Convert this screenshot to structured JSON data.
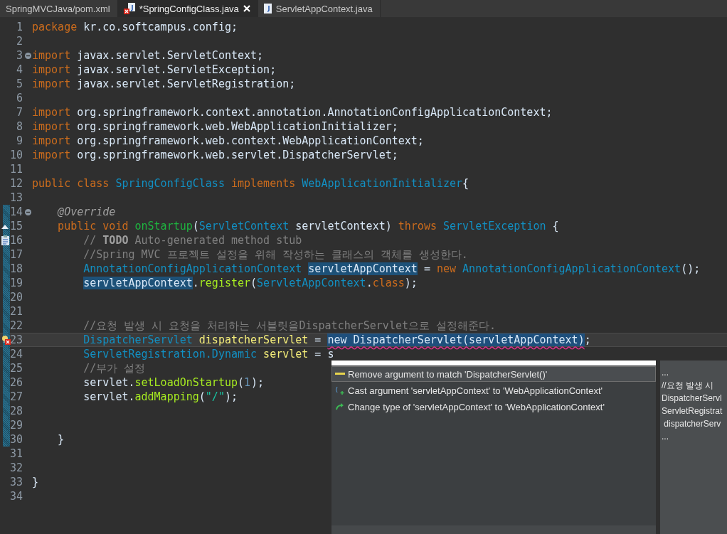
{
  "tabs": [
    {
      "label": "SpringMVCJava/pom.xml",
      "kind": "xml",
      "selected": false
    },
    {
      "label": "*SpringConfigClass.java",
      "kind": "java-error",
      "selected": true
    },
    {
      "label": "ServletAppContext.java",
      "kind": "java",
      "selected": false
    }
  ],
  "lines": [
    {
      "number": "1",
      "kind": "plain",
      "fold": false,
      "ruler": false,
      "current": false,
      "segments": [
        {
          "text": "package ",
          "kind": "kw"
        },
        {
          "text": "kr.co.softcampus.config;",
          "kind": "tx"
        }
      ]
    },
    {
      "number": "2",
      "kind": "plain",
      "fold": false,
      "ruler": false,
      "current": false
    },
    {
      "number": "3",
      "kind": "plain",
      "fold": true,
      "ruler": false,
      "current": false,
      "segments": [
        {
          "text": "import ",
          "kind": "kw"
        },
        {
          "text": "javax.servlet.ServletContext;",
          "kind": "tx"
        }
      ]
    },
    {
      "number": "4",
      "kind": "plain",
      "fold": false,
      "ruler": false,
      "current": false,
      "segments": [
        {
          "text": "import ",
          "kind": "kw"
        },
        {
          "text": "javax.servlet.ServletException;",
          "kind": "tx"
        }
      ]
    },
    {
      "number": "5",
      "kind": "plain",
      "fold": false,
      "ruler": false,
      "current": false,
      "segments": [
        {
          "text": "import ",
          "kind": "kw"
        },
        {
          "text": "javax.servlet.ServletRegistration;",
          "kind": "tx"
        }
      ]
    },
    {
      "number": "6",
      "kind": "plain",
      "fold": false,
      "ruler": false,
      "current": false
    },
    {
      "number": "7",
      "kind": "plain",
      "fold": false,
      "ruler": false,
      "current": false,
      "segments": [
        {
          "text": "import ",
          "kind": "kw"
        },
        {
          "text": "org.springframework.context.annotation.AnnotationConfigApplicationContext;",
          "kind": "tx"
        }
      ]
    },
    {
      "number": "8",
      "kind": "plain",
      "fold": false,
      "ruler": false,
      "current": false,
      "segments": [
        {
          "text": "import ",
          "kind": "kw"
        },
        {
          "text": "org.springframework.web.WebApplicationInitializer;",
          "kind": "tx"
        }
      ]
    },
    {
      "number": "9",
      "kind": "plain",
      "fold": false,
      "ruler": false,
      "current": false,
      "segments": [
        {
          "text": "import ",
          "kind": "kw"
        },
        {
          "text": "org.springframework.web.context.WebApplicationContext;",
          "kind": "tx"
        }
      ]
    },
    {
      "number": "10",
      "kind": "plain",
      "fold": false,
      "ruler": false,
      "current": false,
      "segments": [
        {
          "text": "import ",
          "kind": "kw"
        },
        {
          "text": "org.springframework.web.servlet.DispatcherServlet;",
          "kind": "tx"
        }
      ]
    },
    {
      "number": "11",
      "kind": "plain",
      "fold": false,
      "ruler": false,
      "current": false
    },
    {
      "number": "12",
      "kind": "plain",
      "fold": false,
      "ruler": false,
      "current": false,
      "segments": [
        {
          "text": "public class ",
          "kind": "kw"
        },
        {
          "text": "SpringConfigClass ",
          "kind": "type"
        },
        {
          "text": "implements ",
          "kind": "kw"
        },
        {
          "text": "WebApplicationInitializer",
          "kind": "type"
        },
        {
          "text": "{",
          "kind": "tx"
        }
      ]
    },
    {
      "number": "13",
      "kind": "plain",
      "fold": false,
      "ruler": false,
      "current": false
    },
    {
      "number": "14",
      "kind": "plain",
      "fold": true,
      "ruler": true,
      "current": false,
      "segments": [
        {
          "text": "    @Override",
          "kind": "ann"
        }
      ]
    },
    {
      "number": "15",
      "kind": "override",
      "fold": false,
      "ruler": true,
      "current": false,
      "segments": [
        {
          "text": "    public void ",
          "kind": "kw"
        },
        {
          "text": "onStartup",
          "kind": "fn"
        },
        {
          "text": "(",
          "kind": "tx"
        },
        {
          "text": "ServletContext ",
          "kind": "type"
        },
        {
          "text": "servletContext) ",
          "kind": "tx"
        },
        {
          "text": "throws ",
          "kind": "kw"
        },
        {
          "text": "ServletException",
          "kind": "type"
        },
        {
          "text": " {",
          "kind": "tx"
        }
      ]
    },
    {
      "number": "16",
      "kind": "task",
      "fold": false,
      "ruler": true,
      "current": false,
      "segments": [
        {
          "text": "        // ",
          "kind": "cm"
        },
        {
          "text": "TODO",
          "kind": "cmb"
        },
        {
          "text": " Auto-generated method stub",
          "kind": "cm"
        }
      ]
    },
    {
      "number": "17",
      "kind": "plain",
      "fold": false,
      "ruler": true,
      "current": false,
      "segments": [
        {
          "text": "        //Spring MVC 프로젝트 설정을 위해 작성하는 클래스의 객체를 생성한다.",
          "kind": "cm"
        }
      ]
    },
    {
      "number": "18",
      "kind": "plain",
      "fold": false,
      "ruler": true,
      "current": false,
      "segments": [
        {
          "text": "        AnnotationConfigApplicationContext ",
          "kind": "type"
        },
        {
          "text": "servletAppContext",
          "kind": "mark"
        },
        {
          "text": " = ",
          "kind": "tx"
        },
        {
          "text": "new ",
          "kind": "kw"
        },
        {
          "text": "AnnotationConfigApplicationContext",
          "kind": "type"
        },
        {
          "text": "();",
          "kind": "tx"
        }
      ]
    },
    {
      "number": "19",
      "kind": "plain",
      "fold": false,
      "ruler": true,
      "current": false,
      "segments": [
        {
          "text": "        servletAppContext",
          "kind": "mark"
        },
        {
          "text": ".",
          "kind": "tx"
        },
        {
          "text": "register",
          "kind": "call"
        },
        {
          "text": "(",
          "kind": "tx"
        },
        {
          "text": "ServletAppContext",
          "kind": "type"
        },
        {
          "text": ".",
          "kind": "tx"
        },
        {
          "text": "class",
          "kind": "kw"
        },
        {
          "text": ");",
          "kind": "tx"
        }
      ]
    },
    {
      "number": "20",
      "kind": "plain",
      "fold": false,
      "ruler": true,
      "current": false
    },
    {
      "number": "21",
      "kind": "plain",
      "fold": false,
      "ruler": true,
      "current": false
    },
    {
      "number": "22",
      "kind": "plain",
      "fold": false,
      "ruler": true,
      "current": false,
      "segments": [
        {
          "text": "        //요청 발생 시 요청을 처리하는 서블릿을DispatcherServlet으로 설정해준다.",
          "kind": "cm"
        }
      ]
    },
    {
      "number": "23",
      "kind": "error",
      "fold": false,
      "ruler": true,
      "current": true,
      "segments": [
        {
          "text": "        DispatcherServlet ",
          "kind": "type"
        },
        {
          "text": "dispatcherServlet",
          "kind": "var"
        },
        {
          "text": " = ",
          "kind": "tx"
        },
        {
          "text": "new DispatcherServlet(servletAppContext)",
          "kind": "sel"
        },
        {
          "text": ";",
          "kind": "tx"
        }
      ]
    },
    {
      "number": "24",
      "kind": "plain",
      "fold": false,
      "ruler": true,
      "current": false,
      "segments": [
        {
          "text": "        ServletRegistration.Dynamic ",
          "kind": "type"
        },
        {
          "text": "servlet",
          "kind": "var"
        },
        {
          "text": " = s",
          "kind": "tx"
        }
      ]
    },
    {
      "number": "25",
      "kind": "plain",
      "fold": false,
      "ruler": true,
      "current": false,
      "segments": [
        {
          "text": "        //부가 설정",
          "kind": "cm"
        }
      ]
    },
    {
      "number": "26",
      "kind": "plain",
      "fold": false,
      "ruler": true,
      "current": false,
      "segments": [
        {
          "text": "        servlet.",
          "kind": "tx"
        },
        {
          "text": "setLoadOnStartup",
          "kind": "call"
        },
        {
          "text": "(",
          "kind": "tx"
        },
        {
          "text": "1",
          "kind": "num"
        },
        {
          "text": ");",
          "kind": "tx"
        }
      ]
    },
    {
      "number": "27",
      "kind": "plain",
      "fold": false,
      "ruler": true,
      "current": false,
      "segments": [
        {
          "text": "        servlet.",
          "kind": "tx"
        },
        {
          "text": "addMapping",
          "kind": "call"
        },
        {
          "text": "(",
          "kind": "tx"
        },
        {
          "text": "\"/\"",
          "kind": "str"
        },
        {
          "text": ");",
          "kind": "tx"
        }
      ]
    },
    {
      "number": "28",
      "kind": "plain",
      "fold": false,
      "ruler": true,
      "current": false
    },
    {
      "number": "29",
      "kind": "plain",
      "fold": false,
      "ruler": true,
      "current": false
    },
    {
      "number": "30",
      "kind": "plain",
      "fold": false,
      "ruler": true,
      "current": false,
      "segments": [
        {
          "text": "    }",
          "kind": "tx"
        }
      ]
    },
    {
      "number": "31",
      "kind": "plain",
      "fold": false,
      "ruler": false,
      "current": false
    },
    {
      "number": "32",
      "kind": "plain",
      "fold": false,
      "ruler": false,
      "current": false
    },
    {
      "number": "33",
      "kind": "plain",
      "fold": false,
      "ruler": false,
      "current": false,
      "segments": [
        {
          "text": "}",
          "kind": "tx"
        }
      ]
    },
    {
      "number": "34",
      "kind": "plain",
      "fold": false,
      "ruler": false,
      "current": false
    }
  ],
  "quick_fix": {
    "proposals": [
      {
        "label": "Remove argument to match 'DispatcherServlet()'",
        "kind": "remove",
        "selected": true
      },
      {
        "label": "Cast argument 'servletAppContext' to 'WebApplicationContext'",
        "kind": "cast",
        "selected": false
      },
      {
        "label": "Change type of 'servletAppContext' to 'WebApplicationContext'",
        "kind": "change",
        "selected": false
      }
    ]
  },
  "info_panel": {
    "lines": [
      "...",
      "//요청 발생 시 ",
      "DispatcherServl",
      "ServletRegistrat",
      " dispatcherServ",
      "..."
    ]
  }
}
